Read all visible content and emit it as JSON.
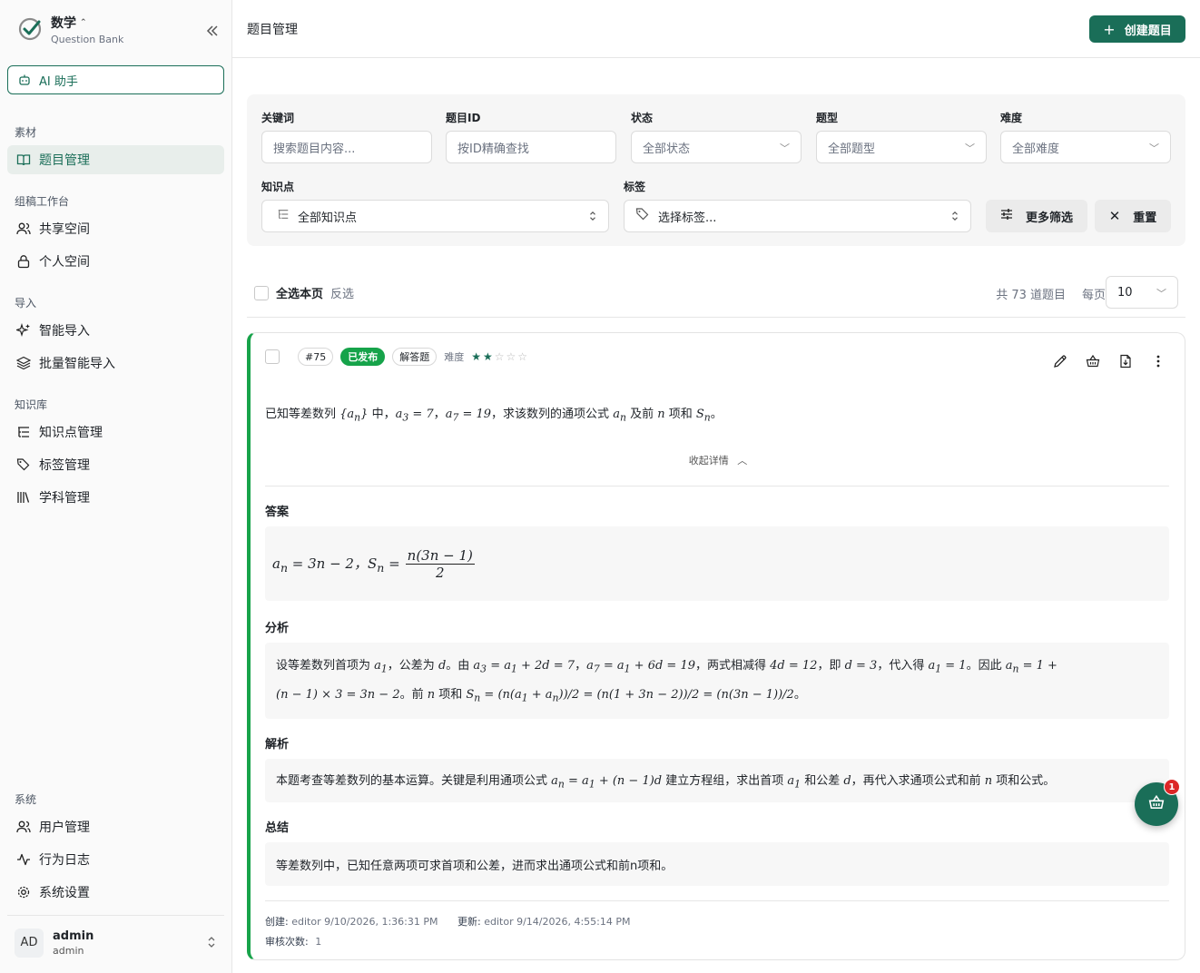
{
  "brand": {
    "title": "数学",
    "subtitle": "Question Bank"
  },
  "ai_button": {
    "label": "AI 助手"
  },
  "sidebar": {
    "sections": {
      "materials": "素材",
      "workspace": "组稿工作台",
      "import": "导入",
      "knowledge": "知识库",
      "system": "系统"
    },
    "items": {
      "questions": "题目管理",
      "shared": "共享空间",
      "personal": "个人空间",
      "smart_import": "智能导入",
      "batch_import": "批量智能导入",
      "knowledge_points": "知识点管理",
      "tags": "标签管理",
      "subjects": "学科管理",
      "users": "用户管理",
      "logs": "行为日志",
      "settings": "系统设置"
    }
  },
  "user": {
    "initials": "AD",
    "name": "admin",
    "role": "admin"
  },
  "header": {
    "title": "题目管理",
    "create_label": "创建题目"
  },
  "filters": {
    "keyword_label": "关键词",
    "keyword_placeholder": "搜索题目内容...",
    "id_label": "题目ID",
    "id_placeholder": "按ID精确查找",
    "status_label": "状态",
    "status_value": "全部状态",
    "type_label": "题型",
    "type_value": "全部题型",
    "difficulty_label": "难度",
    "difficulty_value": "全部难度",
    "knowledge_label": "知识点",
    "knowledge_value": "全部知识点",
    "tag_label": "标签",
    "tag_value": "选择标签...",
    "more_label": "更多筛选",
    "reset_label": "重置"
  },
  "list": {
    "select_all": "全选本页",
    "invert": "反选",
    "total": "共 73 道题目",
    "per_page_label": "每页",
    "per_page_value": "10"
  },
  "question": {
    "id": "#75",
    "status": "已发布",
    "type": "解答题",
    "difficulty_label": "难度",
    "difficulty": 2,
    "difficulty_max": 5,
    "collapse_label": "收起详情",
    "answer_title": "答案",
    "analysis_title": "分析",
    "explanation_title": "解析",
    "summary_title": "总结",
    "summary_text": "等差数列中，已知任意两项可求首项和公差，进而求出通项公式和前n项和。",
    "created_label": "创建:",
    "created_value": "editor  9/10/2026, 1:36:31 PM",
    "updated_label": "更新:",
    "updated_value": "editor  9/14/2026, 4:55:14 PM",
    "review_label": "审核次数:",
    "review_value": "1"
  },
  "cart": {
    "count": "1"
  },
  "colors": {
    "brand": "#1a6e58",
    "published": "#16a34a",
    "badge": "#dc2626"
  }
}
